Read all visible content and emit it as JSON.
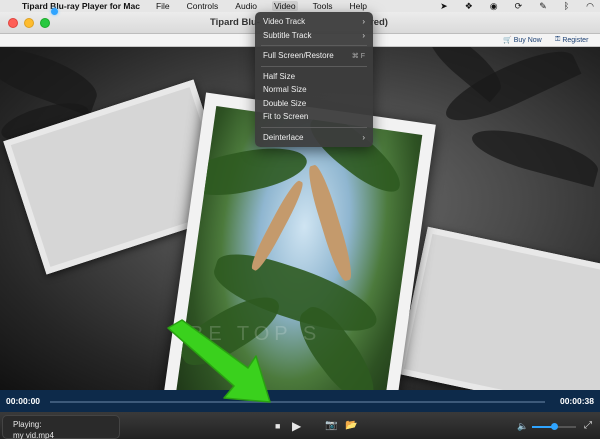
{
  "menubar": {
    "app_name": "Tipard Blu-ray Player for Mac",
    "items": [
      "File",
      "Controls",
      "Audio",
      "Video",
      "Tools",
      "Help"
    ],
    "active_item": "Video",
    "status_icons": [
      "location-icon",
      "dropbox-icon",
      "circle-icon",
      "sync-icon",
      "feather-icon",
      "bluetooth-icon",
      "wifi-icon"
    ]
  },
  "window": {
    "title": "Tipard Blu-",
    "title_tail": "red)"
  },
  "toolbar": {
    "buy_label": "Buy Now",
    "register_label": "Register"
  },
  "video_menu": {
    "groups": [
      [
        {
          "label": "Video Track",
          "submenu": true
        },
        {
          "label": "Subtitle Track",
          "submenu": true
        }
      ],
      [
        {
          "label": "Full Screen/Restore",
          "shortcut": "⌘ F"
        }
      ],
      [
        {
          "label": "Half Size"
        },
        {
          "label": "Normal Size"
        },
        {
          "label": "Double Size"
        },
        {
          "label": "Fit to Screen"
        }
      ],
      [
        {
          "label": "Deinterlace",
          "submenu": true
        }
      ]
    ]
  },
  "video": {
    "watermark": "BE  TOP  S"
  },
  "playback": {
    "current_time": "00:00:00",
    "total_time": "00:00:38",
    "progress": 0.0
  },
  "now_playing": {
    "label": "Playing:",
    "file": "my vid.mp4"
  },
  "volume": {
    "level": 0.45
  },
  "colors": {
    "accent": "#2fa4ff",
    "annotation_arrow": "#3ad11d",
    "timebar": "#0d2a4a"
  }
}
